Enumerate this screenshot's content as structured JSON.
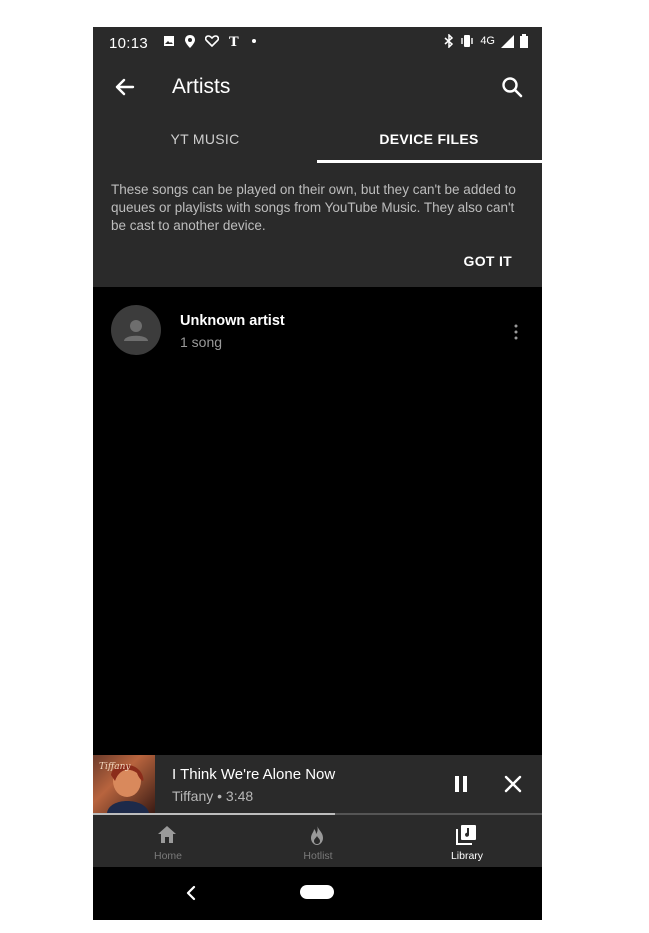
{
  "status_bar": {
    "time": "10:13",
    "network": "4G",
    "icons_left": [
      "image-icon",
      "location-pin-icon",
      "heart-pulse-icon",
      "nyt-icon",
      "dot-icon"
    ],
    "icons_right": [
      "bluetooth-icon",
      "vibrate-icon",
      "signal-icon",
      "battery-icon"
    ]
  },
  "appbar": {
    "title": "Artists"
  },
  "tabs": [
    {
      "label": "YT MUSIC",
      "active": false
    },
    {
      "label": "DEVICE FILES",
      "active": true
    }
  ],
  "banner": {
    "text": "These songs can be played on their own, but they can't be added to queues or playlists with songs from YouTube Music. They also can't be cast to another device.",
    "action_label": "GOT IT"
  },
  "artists": [
    {
      "name": "Unknown artist",
      "subtitle": "1 song"
    }
  ],
  "now_playing": {
    "title": "I Think We're Alone Now",
    "subtitle": "Tiffany • 3:48",
    "progress": 0.54
  },
  "bottom_nav": [
    {
      "label": "Home",
      "icon": "home-icon",
      "active": false
    },
    {
      "label": "Hotlist",
      "icon": "flame-icon",
      "active": false
    },
    {
      "label": "Library",
      "icon": "library-icon",
      "active": true
    }
  ],
  "colors": {
    "surface": "#2a2a2a",
    "background": "#000000",
    "text_primary": "#ffffff",
    "text_secondary": "#9a9a9a"
  }
}
